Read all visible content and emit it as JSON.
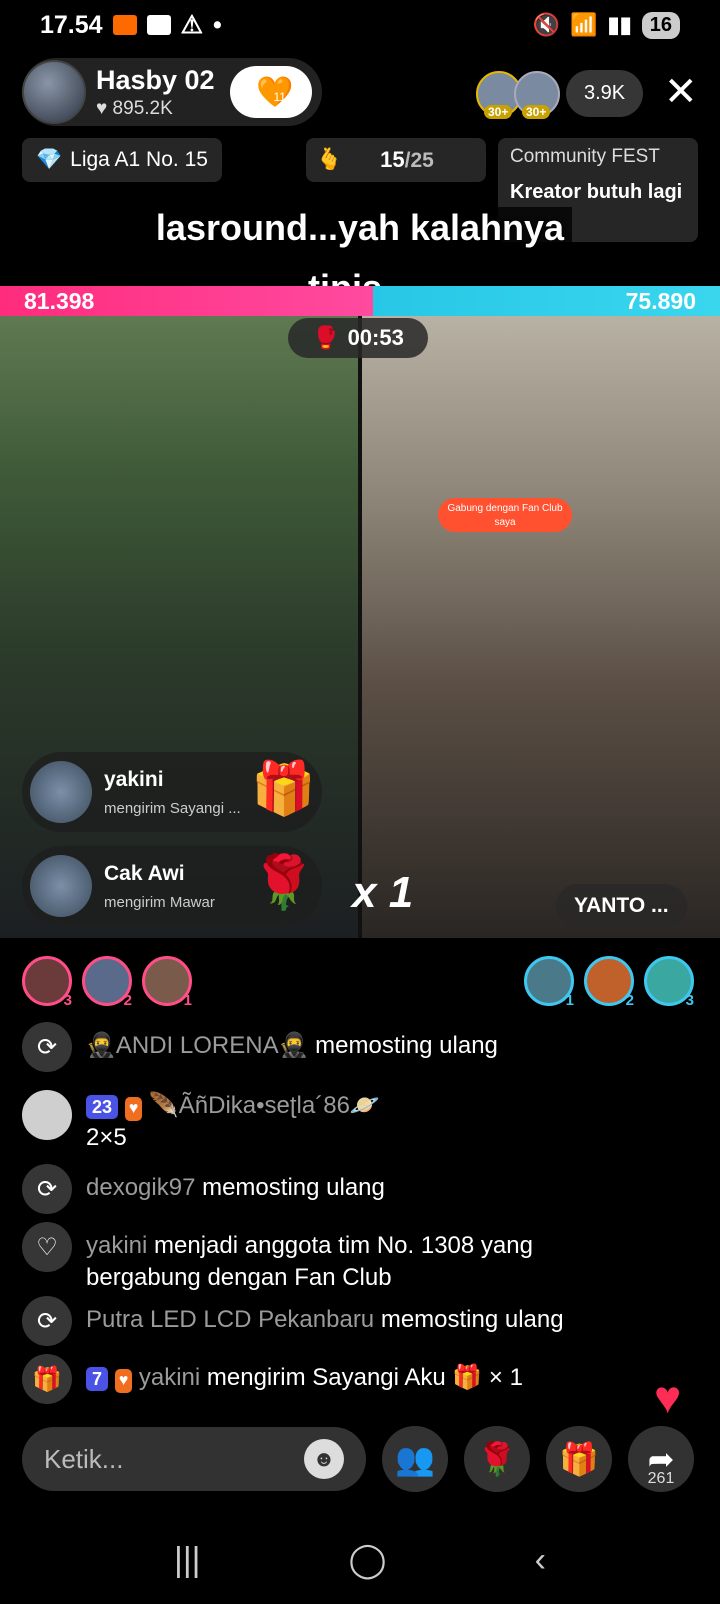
{
  "status": {
    "time": "17.54",
    "battery": "16"
  },
  "host": {
    "name": "Hasby 02",
    "likes": "♥ 895.2K",
    "follow_count": "11"
  },
  "viewers": {
    "badges": [
      "30+",
      "30+"
    ],
    "count": "3.9K"
  },
  "liga": {
    "label": "Liga A1 No. 15"
  },
  "progress": {
    "value": "15",
    "total": "/25"
  },
  "community": {
    "title": "Community FEST",
    "text": "Kreator butuh lagi"
  },
  "caption": {
    "line1": "lasround...yah kalahnya",
    "line2": "tipis..."
  },
  "battle": {
    "left_score": "81.398",
    "right_score": "75.890",
    "timer": "00:53"
  },
  "gifts": [
    {
      "name": "yakini",
      "desc": "mengirim Sayangi ..."
    },
    {
      "name": "Cak Awi",
      "desc": "mengirim Mawar"
    }
  ],
  "combo": "x 1",
  "opponent": {
    "name": "YANTO ...",
    "fanclub": "Gabung dengan Fan Club saya"
  },
  "supporters_left": [
    "3",
    "2",
    "1"
  ],
  "supporters_right": [
    "1",
    "2",
    "3"
  ],
  "chat": [
    {
      "user": "🥷ANDI LORENA🥷",
      "msg": "memosting ulang"
    },
    {
      "level": "23",
      "user": "🪶ÃñDika•seʈla´86🪐",
      "msg": "2×5"
    },
    {
      "user": "dexogik97",
      "msg": "memosting ulang"
    },
    {
      "user": "yakini",
      "msg": "menjadi anggota tim No. 1308 yang bergabung dengan Fan Club"
    },
    {
      "user": "Putra LED LCD Pekanbaru",
      "msg": "memosting ulang"
    },
    {
      "level": "7",
      "user": "yakini",
      "msg": "mengirim Sayangi Aku",
      "count": "× 1"
    }
  ],
  "input": {
    "placeholder": "Ketik..."
  },
  "share_count": "261",
  "colors": {
    "pink": "#ff2c7d",
    "cyan": "#27c7e6",
    "level": "#4b53e6"
  }
}
